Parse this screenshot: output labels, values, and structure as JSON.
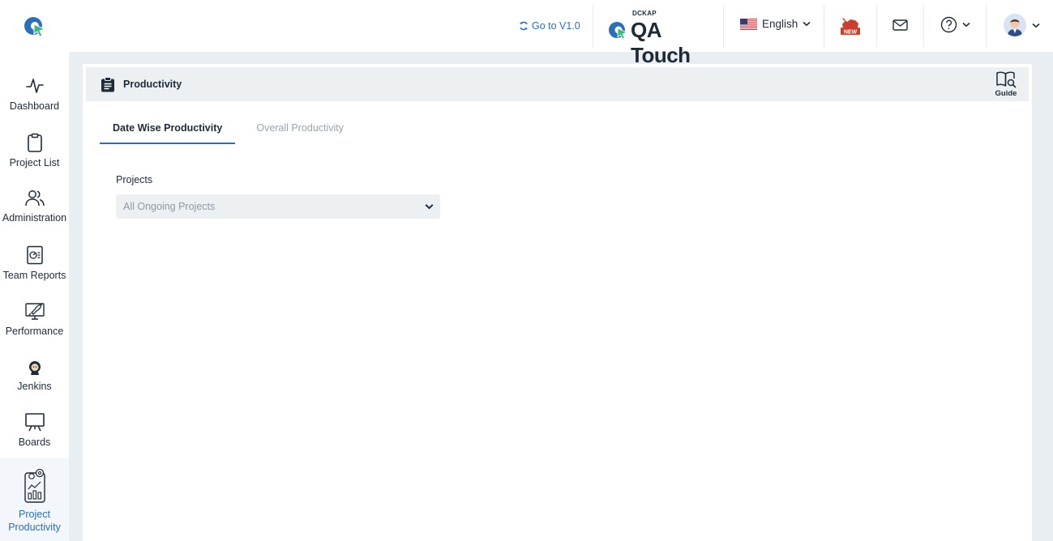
{
  "header": {
    "goto_label": "Go to V1.0",
    "brand_top": "DCKAP",
    "brand_name": "QA Touch",
    "language": "English"
  },
  "sidebar": {
    "items": [
      {
        "label": "Dashboard",
        "icon": "activity-icon"
      },
      {
        "label": "Project List",
        "icon": "clipboard-icon"
      },
      {
        "label": "Administration",
        "icon": "users-icon"
      },
      {
        "label": "Team Reports",
        "icon": "report-icon"
      },
      {
        "label": "Performance",
        "icon": "rocket-monitor-icon"
      },
      {
        "label": "Jenkins",
        "icon": "jenkins-icon"
      },
      {
        "label": "Boards",
        "icon": "board-icon"
      },
      {
        "label": "Project Productivity",
        "icon": "productivity-icon",
        "active": true
      }
    ]
  },
  "page": {
    "title": "Productivity",
    "guide_label": "Guide",
    "tabs": [
      {
        "label": "Date Wise Productivity",
        "active": true
      },
      {
        "label": "Overall Productivity",
        "active": false
      }
    ],
    "projects_label": "Projects",
    "projects_select_value": "All Ongoing Projects"
  },
  "colors": {
    "accent": "#2b6fb6",
    "background": "#e9eef2",
    "header_strip": "#edf0f3"
  }
}
